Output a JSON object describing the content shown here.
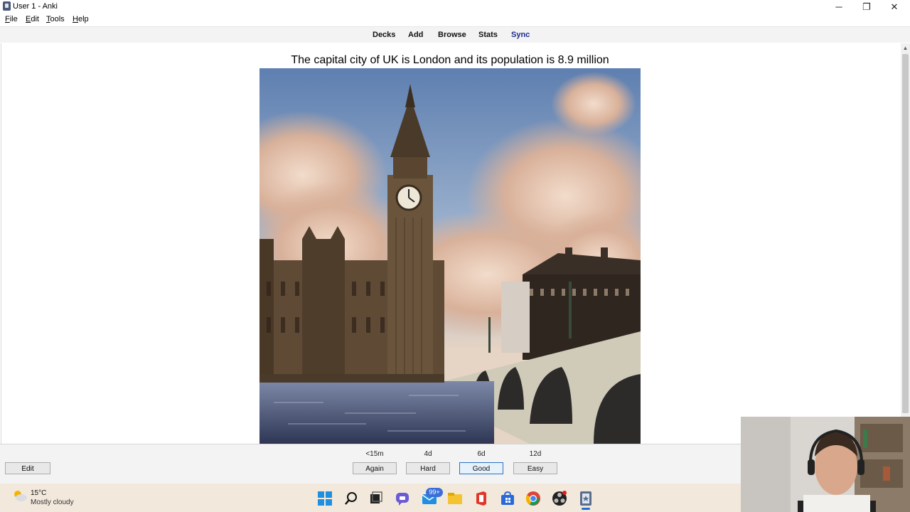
{
  "window": {
    "title": "User 1 - Anki",
    "minimize_glyph": "─",
    "maximize_glyph": "❐",
    "close_glyph": "✕"
  },
  "menu": [
    {
      "label": "File",
      "underline": "F",
      "rest": "ile"
    },
    {
      "label": "Edit",
      "underline": "E",
      "rest": "dit"
    },
    {
      "label": "Tools",
      "underline": "T",
      "rest": "ools"
    },
    {
      "label": "Help",
      "underline": "H",
      "rest": "elp"
    }
  ],
  "toolbar": {
    "decks": "Decks",
    "add": "Add",
    "browse": "Browse",
    "stats": "Stats",
    "sync": "Sync",
    "sync_color": "#1a2a8a"
  },
  "card": {
    "text": "The capital city of UK is London and its population is 8.9 million",
    "image_subject": "Big Ben and the Houses of Parliament beside Westminster Bridge"
  },
  "answer_bar": {
    "edit_label": "Edit",
    "buttons": [
      {
        "label": "Again",
        "interval": "<15m"
      },
      {
        "label": "Hard",
        "interval": "4d"
      },
      {
        "label": "Good",
        "interval": "6d"
      },
      {
        "label": "Easy",
        "interval": "12d"
      }
    ]
  },
  "taskbar": {
    "weather_temp": "15°C",
    "weather_desc": "Mostly cloudy",
    "mail_badge": "99+",
    "icons": [
      "windows-start-icon",
      "search-icon",
      "task-view-icon",
      "chat-icon",
      "mail-icon",
      "file-explorer-icon",
      "office-icon",
      "store-icon",
      "chrome-icon",
      "obs-icon",
      "anki-icon"
    ]
  }
}
